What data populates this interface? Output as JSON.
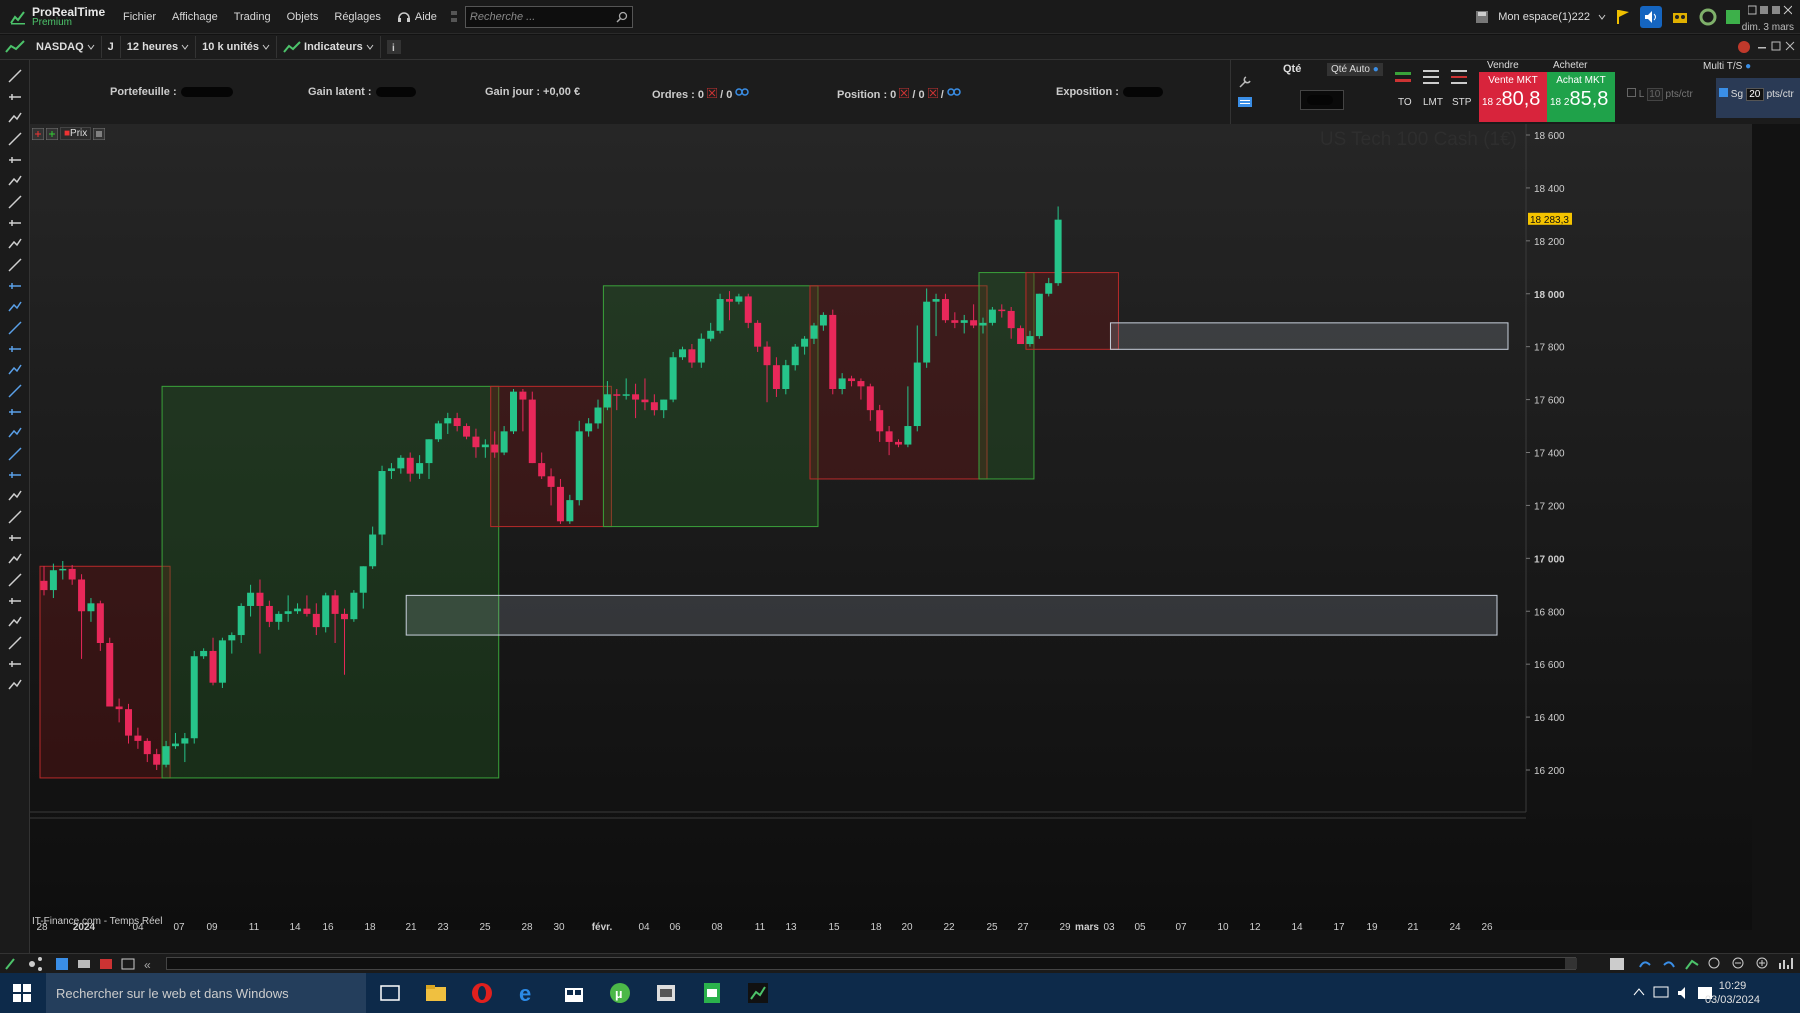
{
  "app": {
    "name": "ProRealTime",
    "edition": "Premium"
  },
  "menu": [
    "Fichier",
    "Affichage",
    "Trading",
    "Objets",
    "Réglages"
  ],
  "help_label": "Aide",
  "search": {
    "placeholder": "Recherche ..."
  },
  "workspace": "Mon espace(1)222",
  "date_short": "dim. 3 mars",
  "toolbar": {
    "instrument": "NASDAQ",
    "mode": "J",
    "timeframe": "12 heures",
    "units": "10 k unités",
    "indicators": "Indicateurs"
  },
  "account": {
    "portefeuille": "Portefeuille :",
    "gain_latent": "Gain latent :",
    "gain_jour": "Gain jour : +0,00 €",
    "ordres": "Ordres : 0",
    "ordres_b": "/ 0",
    "position": "Position : 0",
    "position_b": "/ 0",
    "position_c": "/",
    "exposition": "Exposition :"
  },
  "trade": {
    "qty_label": "Qté",
    "qty_auto": "Qté Auto",
    "order_types": [
      "TO",
      "LMT",
      "STP"
    ],
    "sell_header": "Vendre",
    "buy_header": "Acheter",
    "sell_label": "Vente MKT",
    "buy_label": "Achat MKT",
    "sell_prefix": "18 2",
    "sell_big": "80,8",
    "buy_prefix": "18 2",
    "buy_big": "85,8",
    "multi": "Multi T/S",
    "l_label": "L",
    "l_value": "10",
    "pts": "pts/ctr",
    "sg_label": "Sg",
    "sg_value": "20",
    "pts2": "pts/ctr"
  },
  "chart": {
    "title": "US Tech 100 Cash (1€)",
    "price_tag": "18 283,3",
    "source": "IT-Finance.com - Temps Réel",
    "price_label_btn": "Prix",
    "colors": {
      "up": "#26c48a",
      "down": "#e8285a",
      "green_box": "#3aa23a",
      "red_box": "#b82a2a"
    }
  },
  "chart_data": {
    "type": "candlestick",
    "y_ticks": [
      "18 600",
      "18 400",
      "18 200",
      "18 000",
      "17 800",
      "17 600",
      "17 400",
      "17 200",
      "17 000",
      "16 800",
      "16 600",
      "16 400",
      "16 200"
    ],
    "ylim": [
      16100,
      18700
    ],
    "x_ticks": [
      "28",
      "2024",
      "04",
      "07",
      "09",
      "11",
      "14",
      "16",
      "18",
      "21",
      "23",
      "25",
      "28",
      "30",
      "févr.",
      "04",
      "06",
      "08",
      "11",
      "13",
      "15",
      "18",
      "20",
      "22",
      "25",
      "27",
      "29",
      "mars",
      "03",
      "05",
      "07",
      "10",
      "12",
      "14",
      "17",
      "19",
      "21",
      "24",
      "26"
    ],
    "current_price": 18283.3,
    "candles": [
      [
        16915,
        16970,
        16860,
        16880
      ],
      [
        16880,
        16980,
        16850,
        16955
      ],
      [
        16955,
        16990,
        16920,
        16960
      ],
      [
        16960,
        16975,
        16900,
        16920
      ],
      [
        16920,
        16940,
        16620,
        16800
      ],
      [
        16800,
        16850,
        16760,
        16830
      ],
      [
        16830,
        16840,
        16650,
        16680
      ],
      [
        16680,
        16700,
        16470,
        16440
      ],
      [
        16440,
        16470,
        16380,
        16430
      ],
      [
        16430,
        16450,
        16300,
        16330
      ],
      [
        16330,
        16360,
        16280,
        16310
      ],
      [
        16310,
        16320,
        16230,
        16260
      ],
      [
        16260,
        16280,
        16200,
        16220
      ],
      [
        16220,
        16310,
        16210,
        16290
      ],
      [
        16290,
        16340,
        16280,
        16300
      ],
      [
        16300,
        16340,
        16230,
        16320
      ],
      [
        16320,
        16650,
        16300,
        16630
      ],
      [
        16630,
        16660,
        16620,
        16650
      ],
      [
        16650,
        16700,
        16520,
        16530
      ],
      [
        16530,
        16700,
        16510,
        16690
      ],
      [
        16690,
        16720,
        16640,
        16710
      ],
      [
        16710,
        16830,
        16680,
        16820
      ],
      [
        16820,
        16900,
        16780,
        16870
      ],
      [
        16870,
        16920,
        16640,
        16820
      ],
      [
        16820,
        16840,
        16740,
        16760
      ],
      [
        16760,
        16800,
        16730,
        16790
      ],
      [
        16790,
        16860,
        16760,
        16800
      ],
      [
        16800,
        16830,
        16790,
        16810
      ],
      [
        16810,
        16860,
        16780,
        16790
      ],
      [
        16790,
        16830,
        16710,
        16740
      ],
      [
        16740,
        16870,
        16720,
        16860
      ],
      [
        16860,
        16880,
        16680,
        16790
      ],
      [
        16790,
        16810,
        16560,
        16770
      ],
      [
        16770,
        16880,
        16760,
        16870
      ],
      [
        16870,
        16970,
        16810,
        16970
      ],
      [
        16970,
        17120,
        16960,
        17090
      ],
      [
        17090,
        17350,
        17050,
        17330
      ],
      [
        17330,
        17360,
        17300,
        17340
      ],
      [
        17340,
        17390,
        17320,
        17380
      ],
      [
        17380,
        17400,
        17290,
        17320
      ],
      [
        17320,
        17390,
        17300,
        17360
      ],
      [
        17360,
        17450,
        17300,
        17450
      ],
      [
        17450,
        17520,
        17440,
        17510
      ],
      [
        17510,
        17550,
        17470,
        17530
      ],
      [
        17530,
        17550,
        17480,
        17500
      ],
      [
        17500,
        17510,
        17450,
        17460
      ],
      [
        17460,
        17490,
        17380,
        17420
      ],
      [
        17420,
        17450,
        17380,
        17430
      ],
      [
        17430,
        17480,
        17380,
        17400
      ],
      [
        17400,
        17500,
        17390,
        17480
      ],
      [
        17480,
        17640,
        17470,
        17630
      ],
      [
        17630,
        17640,
        17480,
        17600
      ],
      [
        17600,
        17630,
        17360,
        17360
      ],
      [
        17360,
        17400,
        17300,
        17310
      ],
      [
        17310,
        17340,
        17200,
        17270
      ],
      [
        17270,
        17300,
        17130,
        17140
      ],
      [
        17140,
        17240,
        17130,
        17220
      ],
      [
        17220,
        17520,
        17200,
        17480
      ],
      [
        17480,
        17530,
        17460,
        17510
      ],
      [
        17510,
        17600,
        17490,
        17570
      ],
      [
        17570,
        17670,
        17560,
        17620
      ],
      [
        17620,
        17640,
        17560,
        17615
      ],
      [
        17615,
        17680,
        17600,
        17620
      ],
      [
        17620,
        17660,
        17530,
        17600
      ],
      [
        17600,
        17680,
        17560,
        17590
      ],
      [
        17590,
        17620,
        17540,
        17560
      ],
      [
        17560,
        17600,
        17530,
        17600
      ],
      [
        17600,
        17780,
        17590,
        17760
      ],
      [
        17760,
        17800,
        17750,
        17790
      ],
      [
        17790,
        17810,
        17720,
        17740
      ],
      [
        17740,
        17850,
        17720,
        17830
      ],
      [
        17830,
        17890,
        17820,
        17860
      ],
      [
        17860,
        18000,
        17850,
        17980
      ],
      [
        17980,
        18010,
        17900,
        17970
      ],
      [
        17970,
        18000,
        17960,
        17990
      ],
      [
        17990,
        18000,
        17870,
        17890
      ],
      [
        17890,
        17900,
        17780,
        17800
      ],
      [
        17800,
        17820,
        17590,
        17730
      ],
      [
        17730,
        17760,
        17610,
        17640
      ],
      [
        17640,
        17750,
        17620,
        17730
      ],
      [
        17730,
        17810,
        17710,
        17800
      ],
      [
        17800,
        17840,
        17770,
        17830
      ],
      [
        17830,
        17890,
        17810,
        17880
      ],
      [
        17880,
        17930,
        17860,
        17920
      ],
      [
        17920,
        17940,
        17620,
        17640
      ],
      [
        17640,
        17700,
        17620,
        17680
      ],
      [
        17680,
        17690,
        17650,
        17670
      ],
      [
        17670,
        17680,
        17600,
        17650
      ],
      [
        17650,
        17660,
        17520,
        17560
      ],
      [
        17560,
        17580,
        17440,
        17480
      ],
      [
        17480,
        17500,
        17390,
        17440
      ],
      [
        17440,
        17450,
        17420,
        17430
      ],
      [
        17430,
        17650,
        17420,
        17500
      ],
      [
        17500,
        17880,
        17480,
        17740
      ],
      [
        17740,
        18020,
        17720,
        17970
      ],
      [
        17970,
        18000,
        17840,
        17980
      ],
      [
        17980,
        18000,
        17890,
        17900
      ],
      [
        17900,
        17930,
        17870,
        17890
      ],
      [
        17890,
        17920,
        17850,
        17900
      ],
      [
        17900,
        17960,
        17870,
        17880
      ],
      [
        17880,
        17910,
        17850,
        17890
      ],
      [
        17890,
        17950,
        17880,
        17940
      ],
      [
        17940,
        17960,
        17910,
        17935
      ],
      [
        17935,
        17950,
        17830,
        17870
      ],
      [
        17870,
        17880,
        17820,
        17810
      ],
      [
        17810,
        17860,
        17800,
        17840
      ],
      [
        17840,
        18000,
        17830,
        18000
      ],
      [
        18000,
        18060,
        17990,
        18040
      ],
      [
        18040,
        18330,
        18030,
        18280
      ]
    ],
    "boxes": [
      {
        "color": "red",
        "from_candle": 0,
        "to_candle": 13,
        "high": 16970,
        "low": 16170
      },
      {
        "color": "green",
        "from_candle": 13,
        "to_candle": 48,
        "high": 17650,
        "low": 16170
      },
      {
        "color": "red",
        "from_candle": 48,
        "to_candle": 60,
        "high": 17650,
        "low": 17120
      },
      {
        "color": "green",
        "from_candle": 60,
        "to_candle": 82,
        "high": 18030,
        "low": 17120
      },
      {
        "color": "red",
        "from_candle": 82,
        "to_candle": 100,
        "high": 18030,
        "low": 17300
      },
      {
        "color": "green",
        "from_candle": 100,
        "to_candle": 105,
        "high": 18080,
        "low": 17300
      },
      {
        "color": "red",
        "from_candle": 105,
        "to_candle": 114,
        "high": 18080,
        "low": 17790
      }
    ],
    "zones": [
      {
        "from_candle": 39,
        "to_x_label": "26",
        "high": 16860,
        "low": 16710
      },
      {
        "from_candle": 114,
        "to_x_label": "26",
        "high": 17890,
        "low": 17790
      }
    ]
  },
  "taskbar": {
    "search": "Rechercher sur le web et dans Windows",
    "time": "10:29",
    "date": "03/03/2024"
  }
}
